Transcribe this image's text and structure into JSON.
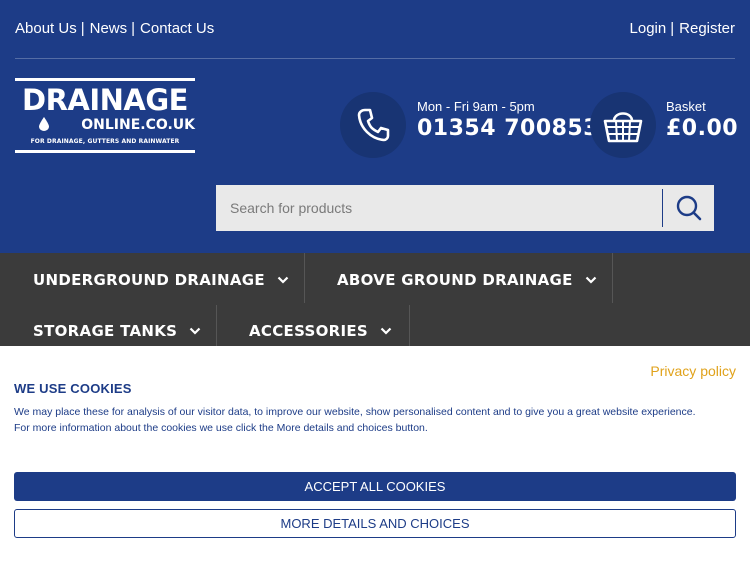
{
  "header": {
    "top_links": [
      "About Us",
      "News",
      "Contact Us"
    ],
    "account_links": [
      "Login",
      "Register"
    ],
    "separator": "|",
    "logo": {
      "main": "DRAINAGE",
      "sub": "ONLINE.CO.UK",
      "tagline": "FOR DRAINAGE, GUTTERS AND RAINWATER"
    },
    "phone": {
      "hours": "Mon - Fri 9am - 5pm",
      "number": "01354 700853",
      "icon": "phone-icon"
    },
    "basket": {
      "label": "Basket",
      "total": "£0.00",
      "icon": "basket-icon"
    },
    "search": {
      "placeholder": "Search for products",
      "icon": "search-icon"
    },
    "colors": {
      "brand": "#1d3c87",
      "nav": "#3b3b3b",
      "accent": "#e0a21b"
    }
  },
  "nav": {
    "items": [
      {
        "label": "UNDERGROUND DRAINAGE"
      },
      {
        "label": "ABOVE GROUND DRAINAGE"
      },
      {
        "label": "STORAGE TANKS"
      },
      {
        "label": "ACCESSORIES"
      }
    ],
    "chevron_icon": "chevron-down-icon"
  },
  "cookie": {
    "privacy_link": "Privacy policy",
    "title": "WE USE COOKIES",
    "text_line1": "We may place these for analysis of our visitor data, to improve our website, show personalised content and to give you a great website experience.",
    "text_line2": "For more information about the cookies we use click the More details and choices button.",
    "accept_label": "ACCEPT ALL COOKIES",
    "more_label": "MORE DETAILS AND CHOICES"
  }
}
